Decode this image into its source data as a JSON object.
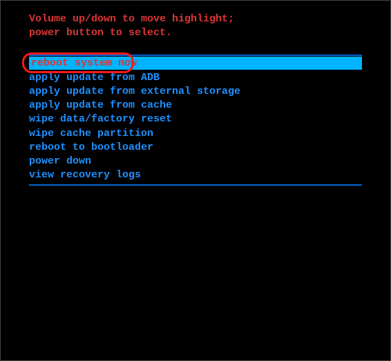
{
  "instructions": {
    "line1": "Volume up/down to move highlight;",
    "line2": "power button to select."
  },
  "menu": {
    "items": [
      {
        "label": "reboot system now",
        "selected": true
      },
      {
        "label": "apply update from ADB",
        "selected": false
      },
      {
        "label": "apply update from external storage",
        "selected": false
      },
      {
        "label": "apply update from cache",
        "selected": false
      },
      {
        "label": "wipe data/factory reset",
        "selected": false
      },
      {
        "label": "wipe cache partition",
        "selected": false
      },
      {
        "label": "reboot to bootloader",
        "selected": false
      },
      {
        "label": "power down",
        "selected": false
      },
      {
        "label": "view recovery logs",
        "selected": false
      }
    ]
  }
}
